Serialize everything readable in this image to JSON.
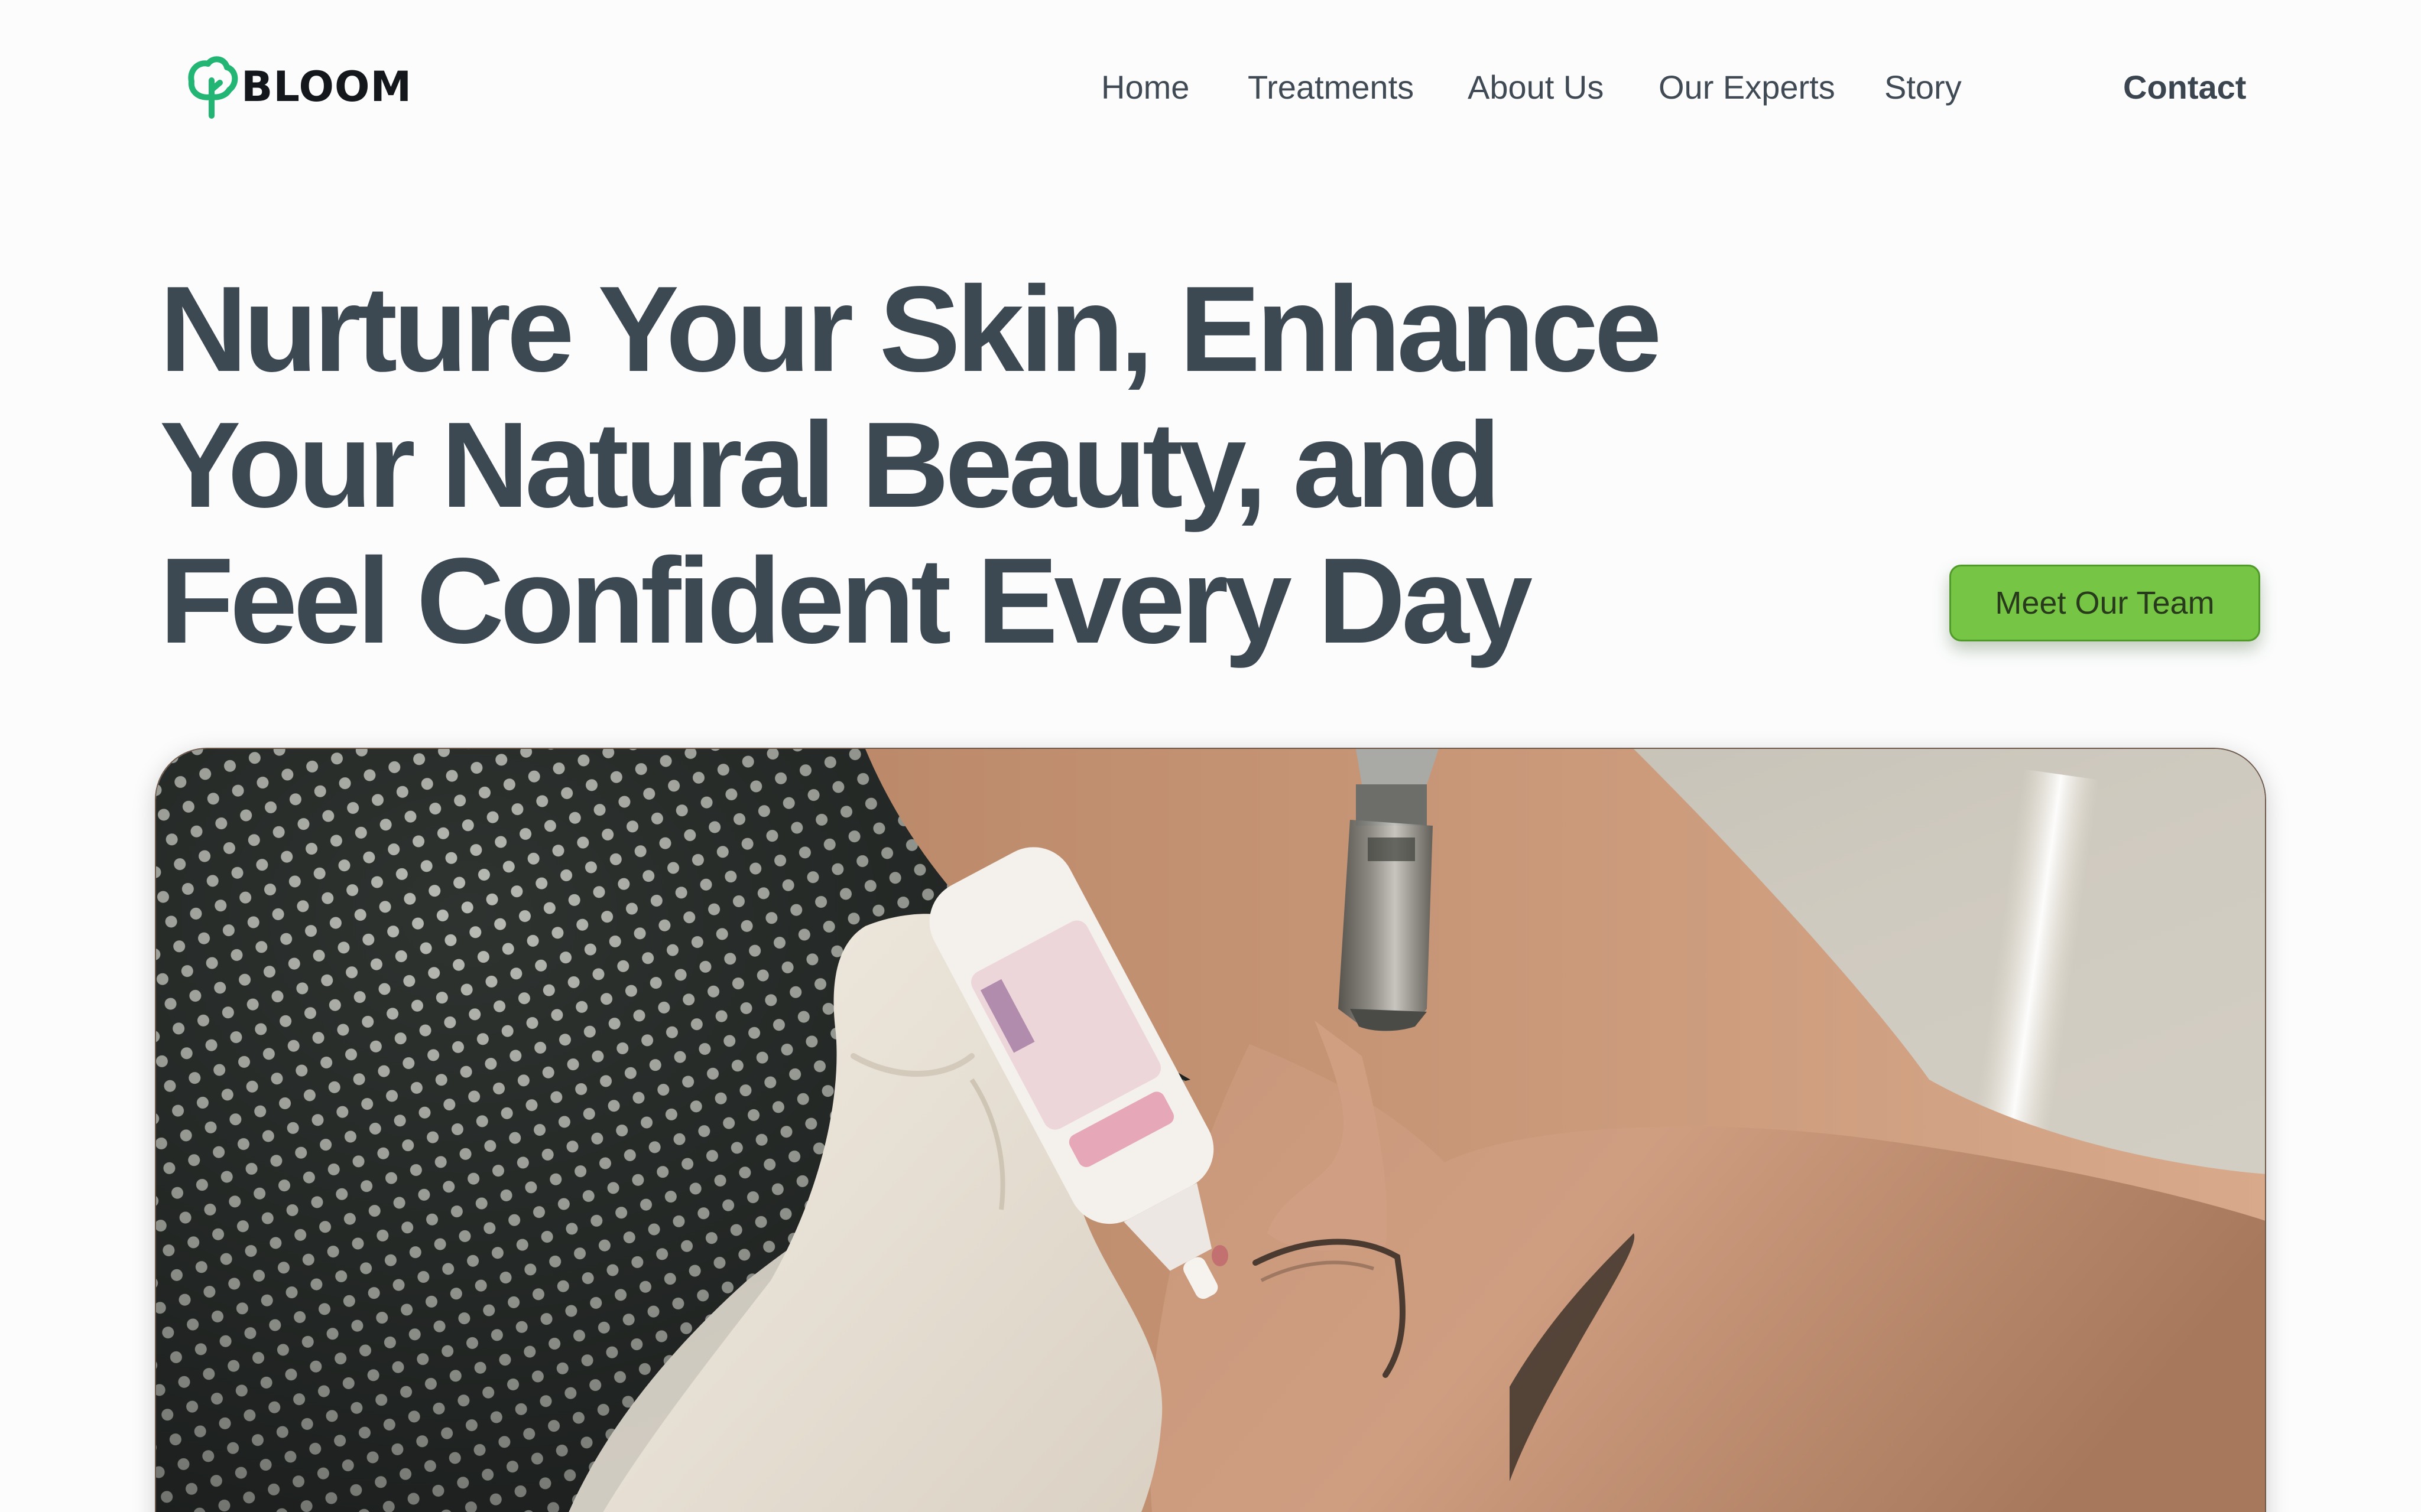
{
  "brand": {
    "name": "BLOOM",
    "logo_icon": "tree-icon",
    "logo_color": "#22b573"
  },
  "nav": {
    "items": [
      "Home",
      "Treatments",
      "About Us",
      "Our Experts",
      "Story"
    ],
    "contact_label": "Contact"
  },
  "hero": {
    "title_lines": [
      "Nurture Your Skin, Enhance",
      "Your Natural Beauty, and",
      "Feel Confident Every Day"
    ],
    "cta_label": "Meet Our Team",
    "cta_color": "#77c544",
    "image": "skincare-treatment-photo"
  },
  "colors": {
    "text": "#3c4852",
    "background": "#fcfcfd"
  }
}
